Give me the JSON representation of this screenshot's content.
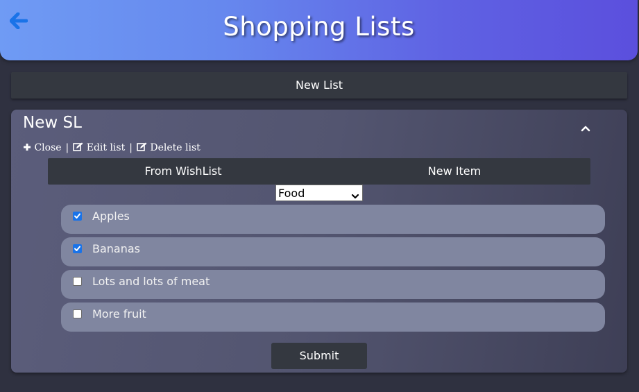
{
  "header": {
    "title": "Shopping Lists",
    "back_icon": "arrow-left-icon",
    "gradient": [
      "#6f9bf4",
      "#5b4fdd"
    ],
    "back_icon_color": "#1a73e8"
  },
  "new_list_label": "New List",
  "list": {
    "title": "New SL",
    "collapse_icon": "chevron-up-icon",
    "actions": {
      "close": "Close",
      "edit": "Edit list",
      "delete": "Delete list",
      "separator": "|"
    },
    "tabs": {
      "from_wishlist": "From WishList",
      "new_item": "New Item"
    },
    "category_select": {
      "value": "Food"
    },
    "items": [
      {
        "label": "Apples",
        "checked": true
      },
      {
        "label": "Bananas",
        "checked": true
      },
      {
        "label": "Lots and lots of meat",
        "checked": false
      },
      {
        "label": "More fruit",
        "checked": false
      }
    ],
    "submit_label": "Submit"
  }
}
